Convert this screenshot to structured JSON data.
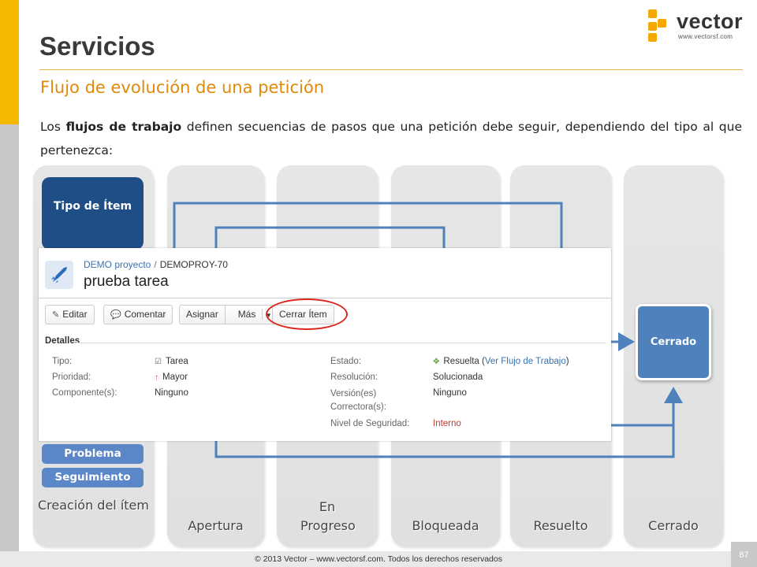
{
  "slide": {
    "title": "Servicios",
    "subtitle": "Flujo de evolución de una petición",
    "body_part1": "Los ",
    "body_bold": "flujos de trabajo",
    "body_part2": " definen secuencias de pasos que una petición debe seguir, dependiendo del tipo al que pertenezca:"
  },
  "logo": {
    "word": "vector",
    "url": "www.vectorsf.com",
    "color": "#f5a800"
  },
  "diagram": {
    "tipo_box": "Tipo de Ítem",
    "type_pills": [
      "Problema",
      "Seguimiento"
    ],
    "cerrado_box": "Cerrado",
    "columns": [
      "Creación del ítem",
      "Apertura",
      "En Progreso",
      "Bloqueada",
      "Resuelto",
      "Cerrado"
    ],
    "arrow_color": "#4f81bd"
  },
  "issue_panel": {
    "project": "DEMO proyecto",
    "separator": "/",
    "issue_key": "DEMOPROY-70",
    "title": "prueba tarea",
    "buttons": {
      "edit": "Editar",
      "comment": "Comentar",
      "assign": "Asignar",
      "more": "Más",
      "close": "Cerrar Ítem"
    },
    "details_heading": "Detalles",
    "left_fields": [
      {
        "label": "Tipo:",
        "value": "Tarea",
        "icon": "task-icon"
      },
      {
        "label": "Prioridad:",
        "value": "Mayor",
        "icon": "priority-up-icon"
      },
      {
        "label": "Componente(s):",
        "value": "Ninguno"
      }
    ],
    "right_fields": {
      "estado_label": "Estado:",
      "estado_value": "Resuelta",
      "estado_link": "Ver Flujo de Trabajo",
      "resolucion_label": "Resolución:",
      "resolucion_value": "Solucionada",
      "version_label": "Versión(es) Correctora(s):",
      "version_value": "Ninguno",
      "nivel_label": "Nivel de Seguridad:",
      "nivel_value": "Interno"
    }
  },
  "footer": {
    "text": "© 2013 Vector – www.vectorsf.com. Todos los derechos reservados",
    "page": "87"
  }
}
